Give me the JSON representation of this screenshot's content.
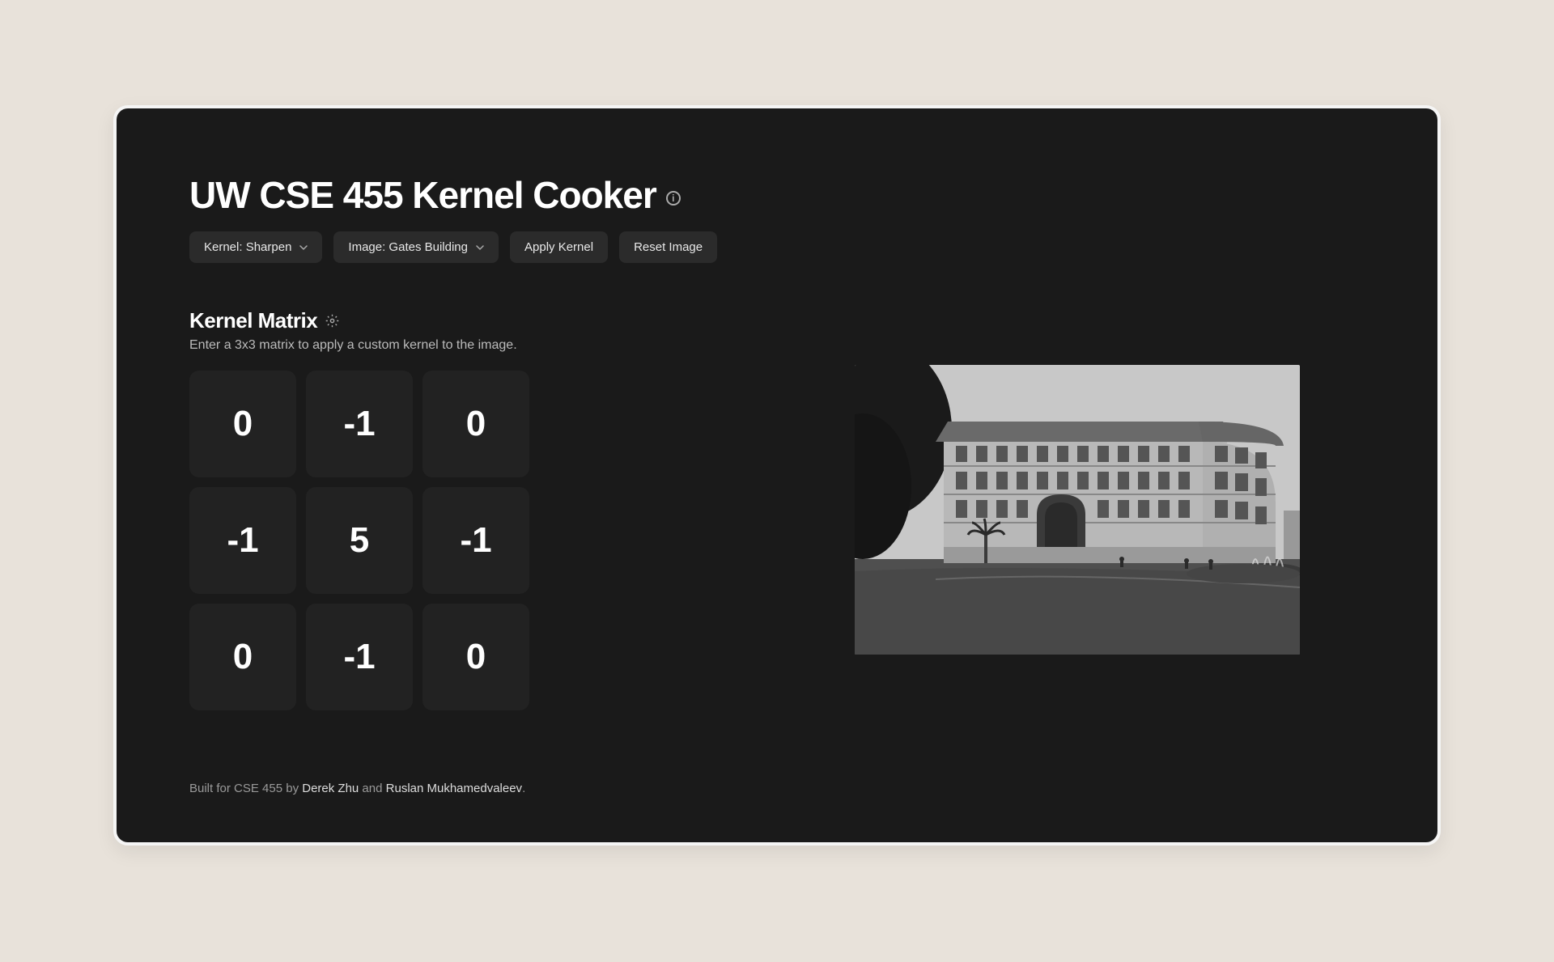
{
  "header": {
    "title": "UW CSE 455 Kernel Cooker"
  },
  "toolbar": {
    "kernel_label": "Kernel: Sharpen",
    "image_label": "Image: Gates Building",
    "apply_label": "Apply Kernel",
    "reset_label": "Reset Image"
  },
  "section": {
    "title": "Kernel Matrix",
    "description": "Enter a 3x3 matrix to apply a custom kernel to the image."
  },
  "matrix": {
    "cells": [
      "0",
      "-1",
      "0",
      "-1",
      "5",
      "-1",
      "0",
      "-1",
      "0"
    ]
  },
  "footer": {
    "prefix": "Built for CSE 455 by ",
    "author1": "Derek Zhu",
    "middle": " and ",
    "author2": "Ruslan Mukhamedvaleev",
    "suffix": "."
  }
}
